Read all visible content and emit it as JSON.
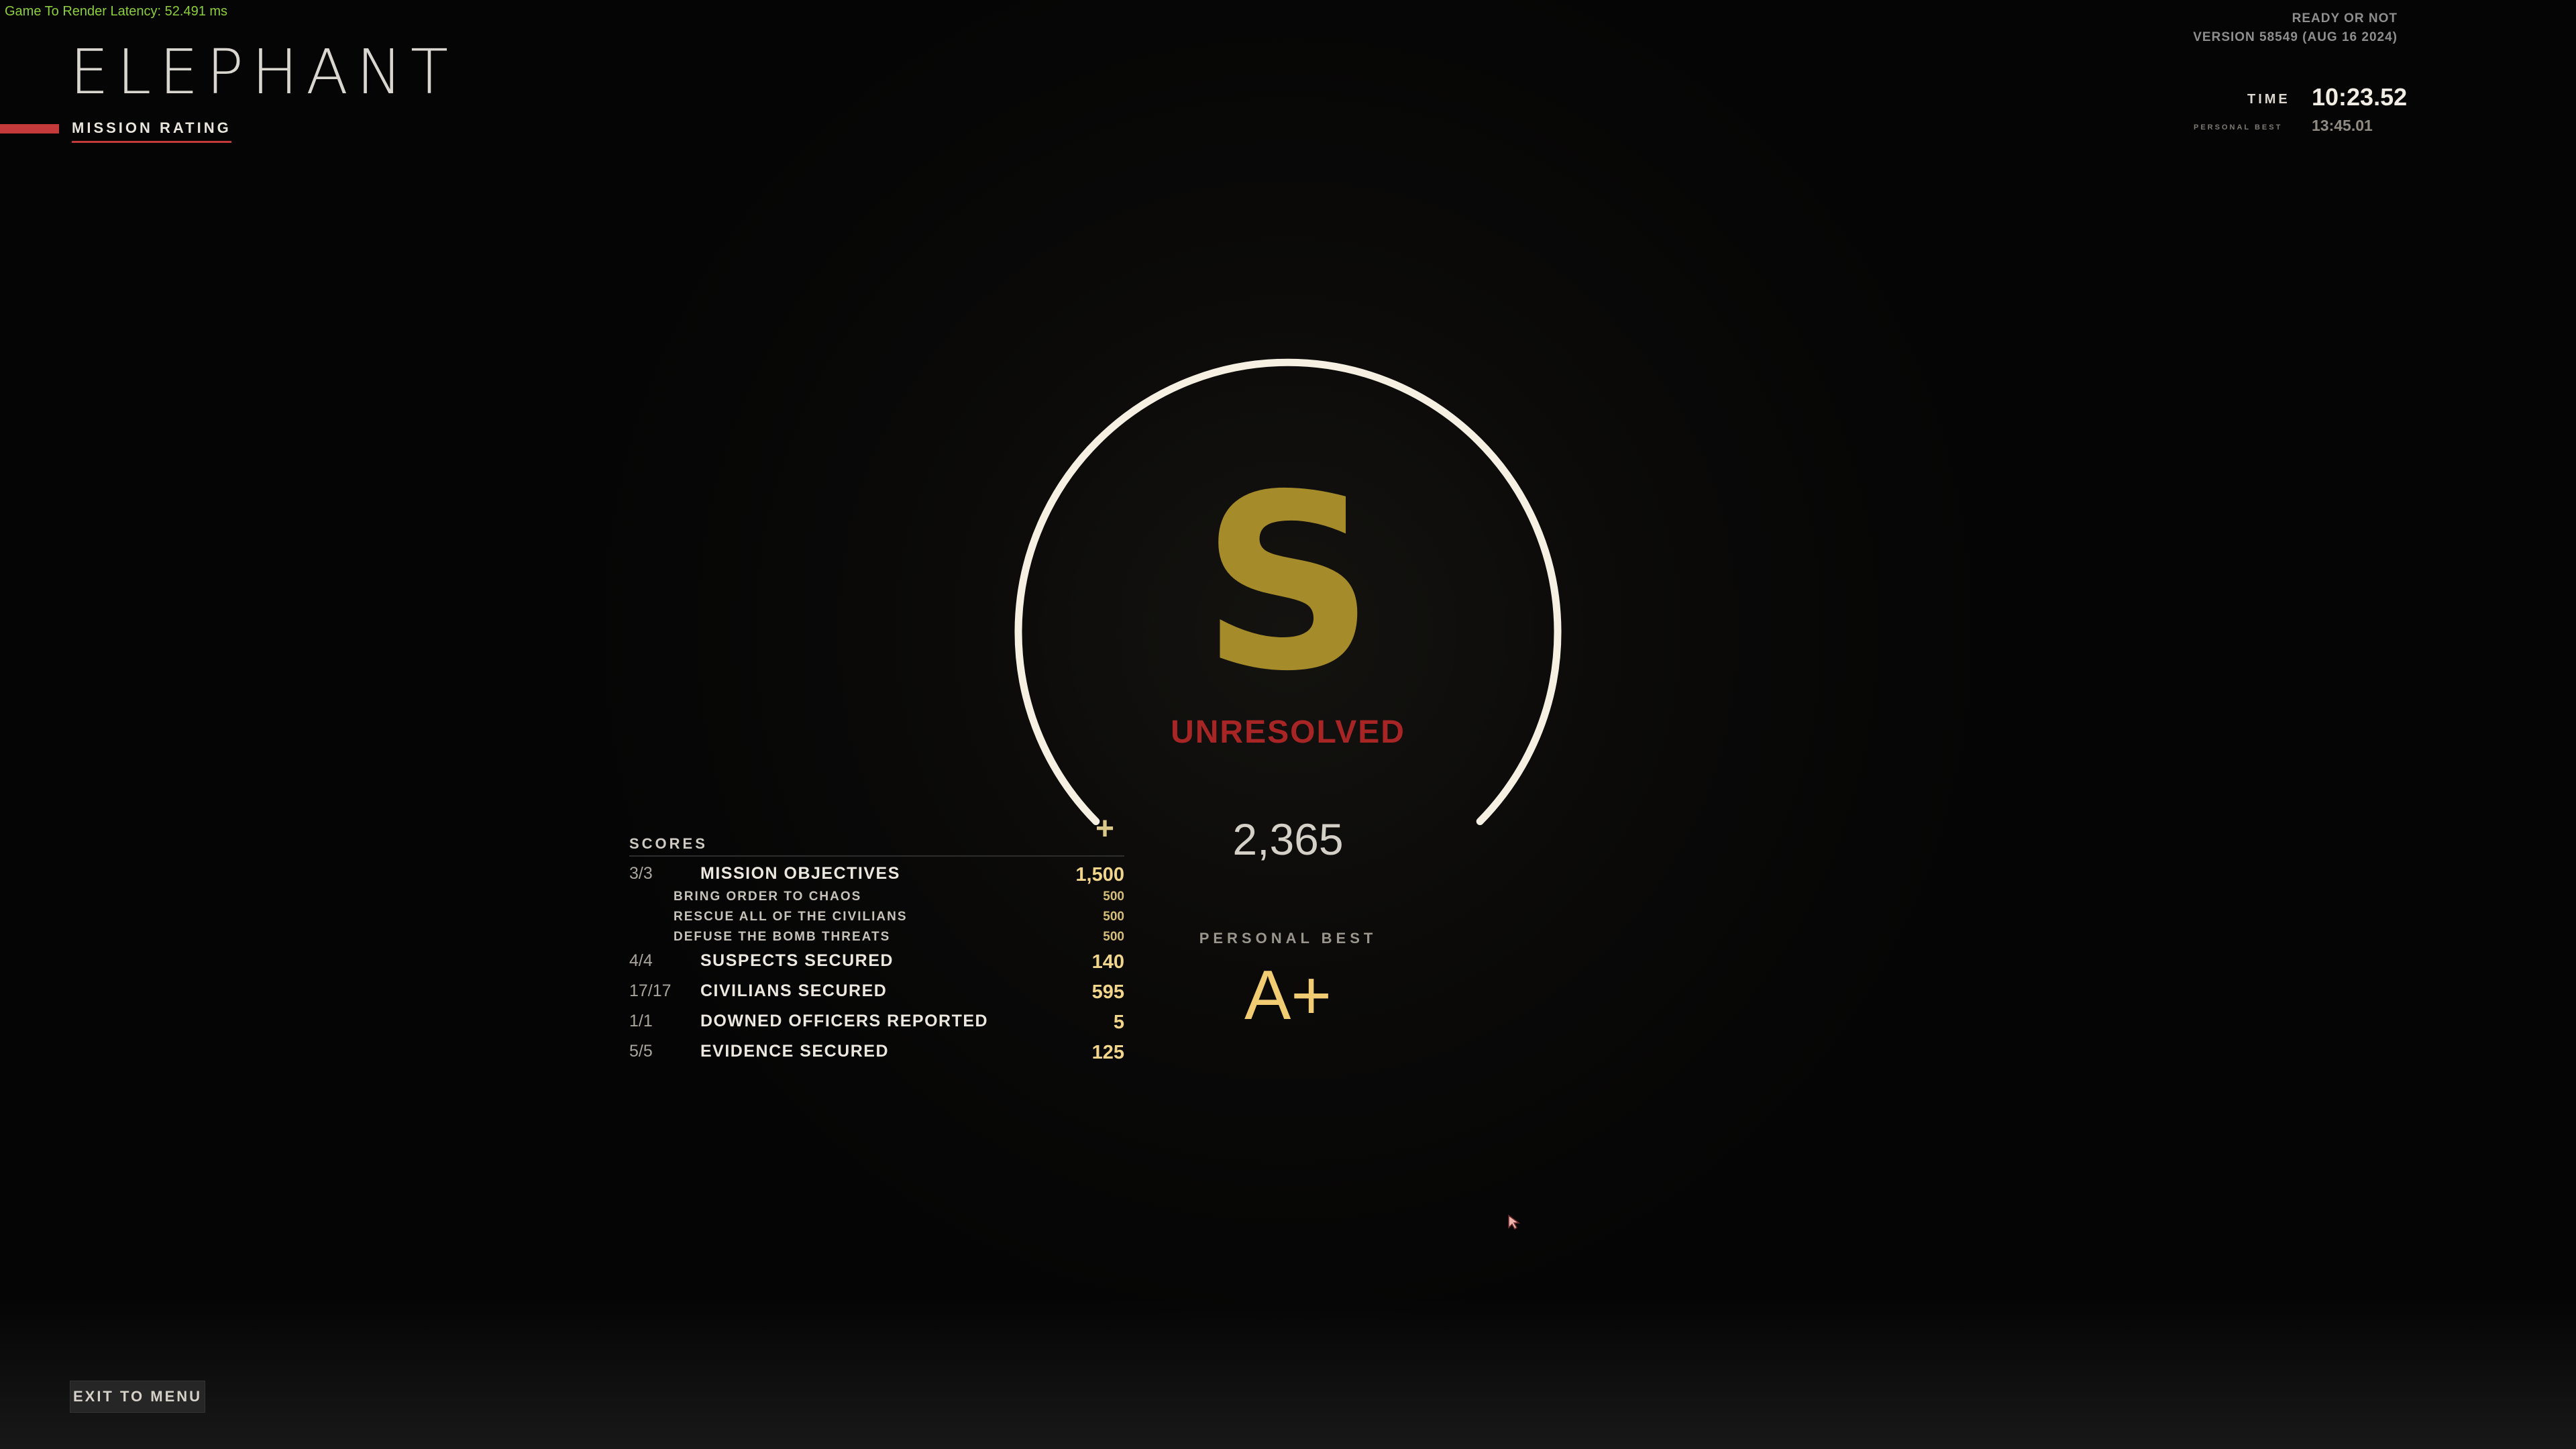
{
  "debug": {
    "latency": "Game To Render Latency: 52.491 ms"
  },
  "header": {
    "map_name": "ELEPHANT",
    "tab_label": "MISSION RATING",
    "accent_color": "#c43a3a"
  },
  "build": {
    "game": "READY OR NOT",
    "version": "VERSION 58549 (AUG 16 2024)"
  },
  "timer": {
    "time_label": "TIME",
    "time_value": "10:23.52",
    "pb_label": "PERSONAL BEST",
    "pb_value": "13:45.01"
  },
  "result": {
    "grade": "S",
    "grade_color": "#a68b2a",
    "status": "UNRESOLVED",
    "status_color": "#a72525",
    "plus_icon": "plus-icon",
    "total_score": "2,365",
    "personal_best_label": "PERSONAL BEST",
    "personal_best_grade": "A+"
  },
  "scores": {
    "header": "SCORES",
    "rows": [
      {
        "count": "3/3",
        "label": "MISSION OBJECTIVES",
        "points": "1,500",
        "sub": [
          {
            "label": "BRING ORDER TO CHAOS",
            "points": "500"
          },
          {
            "label": "RESCUE ALL OF THE CIVILIANS",
            "points": "500"
          },
          {
            "label": "DEFUSE THE BOMB THREATS",
            "points": "500"
          }
        ]
      },
      {
        "count": "4/4",
        "label": "SUSPECTS SECURED",
        "points": "140"
      },
      {
        "count": "17/17",
        "label": "CIVILIANS SECURED",
        "points": "595"
      },
      {
        "count": "1/1",
        "label": "DOWNED OFFICERS REPORTED",
        "points": "5"
      },
      {
        "count": "5/5",
        "label": "EVIDENCE SECURED",
        "points": "125"
      }
    ]
  },
  "footer": {
    "exit_label": "EXIT TO MENU"
  }
}
